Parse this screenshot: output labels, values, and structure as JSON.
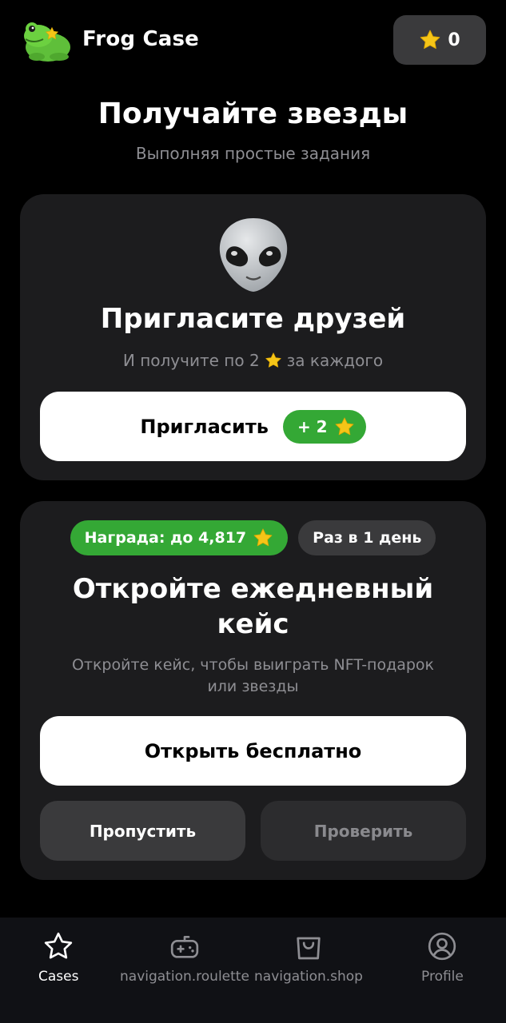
{
  "header": {
    "app_title": "Frog Case",
    "balance": "0"
  },
  "intro": {
    "title": "Получайте звезды",
    "subtitle": "Выполняя простые задания"
  },
  "invite_card": {
    "title": "Пригласите друзей",
    "subtitle_before": "И получите по 2",
    "subtitle_after": "за каждого",
    "button_label": "Пригласить",
    "button_reward": "+ 2"
  },
  "daily_card": {
    "reward_badge": "Награда: до 4,817",
    "frequency_badge": "Раз в 1 день",
    "title_line1": "Откройте ежедневный",
    "title_line2": "кейс",
    "subtitle_line1": "Откройте кейс, чтобы выиграть NFT-подарок",
    "subtitle_line2": "или звезды",
    "open_button": "Открыть бесплатно",
    "skip_button": "Пропустить",
    "check_button": "Проверить"
  },
  "nav": {
    "items": [
      {
        "label": "Cases",
        "icon": "star-icon",
        "active": true
      },
      {
        "label": "navigation.roulette",
        "icon": "gamepad-icon",
        "active": false
      },
      {
        "label": "navigation.shop",
        "icon": "shopping-bag-icon",
        "active": false
      },
      {
        "label": "Profile",
        "icon": "user-circle-icon",
        "active": false
      }
    ]
  },
  "colors": {
    "background": "#000000",
    "card": "#1c1c1e",
    "accent_green": "#34a835",
    "star": "#f5c518",
    "muted_text": "#8e8e93"
  }
}
